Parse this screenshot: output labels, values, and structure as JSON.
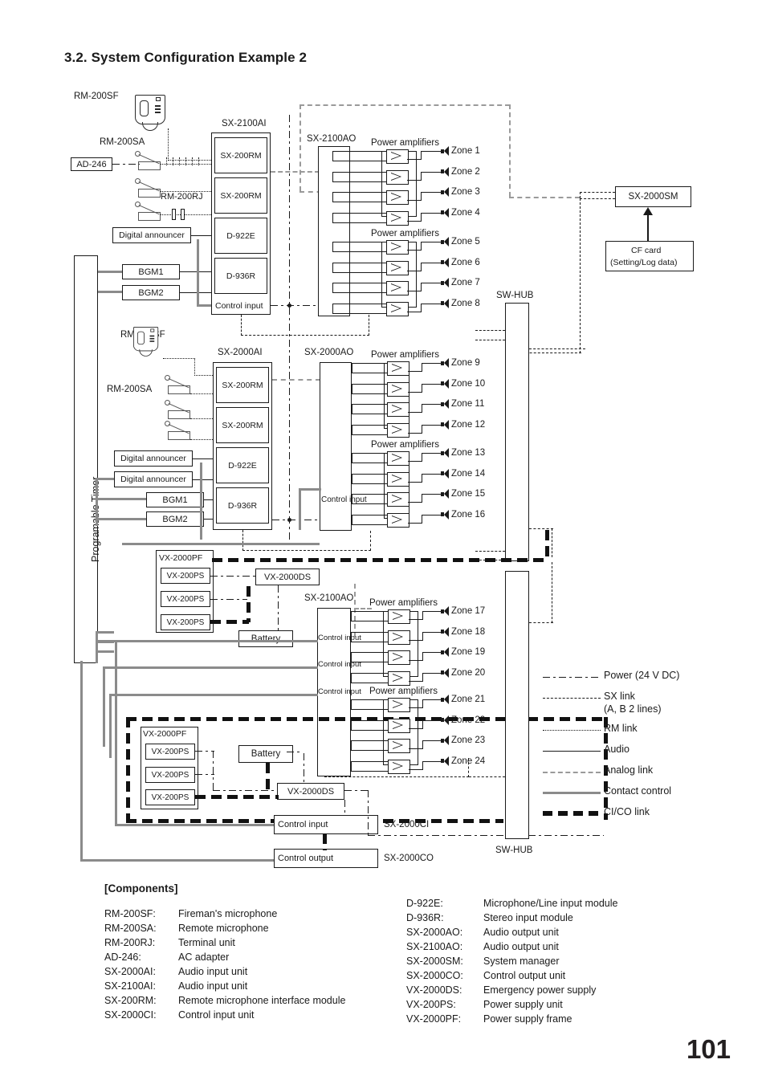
{
  "document": {
    "section_title": "3.2. System Configuration Example 2",
    "page_number": "101"
  },
  "diagram": {
    "programable_timer": "Programable Timer",
    "mic_top_label": "RM-200SF",
    "mic_mid_label": "RM-200SF",
    "rm200sa_top": "RM-200SA",
    "rm200sa_mid": "RM-200SA",
    "ad246": "AD-246",
    "rm200rj": "RM-200RJ",
    "sx2100ai_title": "SX-2100AI",
    "sx2000ai_title": "SX-2000AI",
    "sx2100ao_title_top": "SX-2100AO",
    "sx2000ao_title": "SX-2000AO",
    "sx2100ao_title_bottom": "SX-2100AO",
    "sx2000sm": "SX-2000SM",
    "cf_card_line1": "CF card",
    "cf_card_line2": "(Setting/Log data)",
    "sw_hub_top": "SW-HUB",
    "sw_hub_bottom": "SW-HUB",
    "modules_2100ai": [
      "SX-200RM",
      "SX-200RM",
      "D-922E",
      "D-936R",
      "Control input"
    ],
    "modules_2000ai": [
      "SX-200RM",
      "SX-200RM",
      "D-922E",
      "D-936R"
    ],
    "digital_announcer": "Digital announcer",
    "bgm1": "BGM1",
    "bgm2": "BGM2",
    "control_input": "Control input",
    "control_output": "Control output",
    "power_amplifiers": "Power amplifiers",
    "zones": [
      "Zone 1",
      "Zone 2",
      "Zone 3",
      "Zone 4",
      "Zone 5",
      "Zone 6",
      "Zone 7",
      "Zone 8",
      "Zone 9",
      "Zone 10",
      "Zone 11",
      "Zone 12",
      "Zone 13",
      "Zone 14",
      "Zone 15",
      "Zone 16",
      "Zone 17",
      "Zone 18",
      "Zone 19",
      "Zone 20",
      "Zone 21",
      "Zone 22",
      "Zone 23",
      "Zone 24"
    ],
    "vx2000pf": "VX-2000PF",
    "vx200ps": "VX-200PS",
    "vx2000ds": "VX-2000DS",
    "battery": "Battery",
    "sx2000ci": "SX-2000CI",
    "sx2000co": "SX-2000CO"
  },
  "legend": {
    "items": [
      {
        "label": "Power (24 V DC)",
        "style": "power-dash-dot",
        "color": "#1a1a1a"
      },
      {
        "label": "SX link",
        "sublabel": "(A, B 2 lines)",
        "style": "long-dash",
        "color": "#1a1a1a"
      },
      {
        "label": "RM link",
        "style": "dotted",
        "color": "#1a1a1a"
      },
      {
        "label": "Audio",
        "style": "solid",
        "color": "#1a1a1a"
      },
      {
        "label": "Analog link",
        "style": "gray-dashed",
        "color": "#9a9a9a"
      },
      {
        "label": "Contact control",
        "style": "gray-solid",
        "color": "#8b8b8b"
      },
      {
        "label": "CI/CO link",
        "style": "thick-dashed",
        "color": "#111111"
      }
    ]
  },
  "components": {
    "heading": "[Components]",
    "left": [
      {
        "code": "RM-200SF:",
        "desc": "Fireman's microphone"
      },
      {
        "code": "RM-200SA:",
        "desc": "Remote microphone"
      },
      {
        "code": "RM-200RJ:",
        "desc": "Terminal unit"
      },
      {
        "code": "AD-246:",
        "desc": "AC adapter"
      },
      {
        "code": "SX-2000AI:",
        "desc": "Audio input unit"
      },
      {
        "code": "SX-2100AI:",
        "desc": "Audio input unit"
      },
      {
        "code": "SX-200RM:",
        "desc": "Remote microphone interface module"
      },
      {
        "code": "SX-2000CI:",
        "desc": "Control input unit"
      }
    ],
    "right": [
      {
        "code": "D-922E:",
        "desc": "Microphone/Line input module"
      },
      {
        "code": "D-936R:",
        "desc": "Stereo input module"
      },
      {
        "code": "SX-2000AO:",
        "desc": "Audio output unit"
      },
      {
        "code": "SX-2100AO:",
        "desc": "Audio output unit"
      },
      {
        "code": "SX-2000SM:",
        "desc": "System manager"
      },
      {
        "code": "SX-2000CO:",
        "desc": "Control output unit"
      },
      {
        "code": "VX-2000DS:",
        "desc": "Emergency power supply"
      },
      {
        "code": "VX-200PS:",
        "desc": "Power supply unit"
      },
      {
        "code": "VX-2000PF:",
        "desc": "Power supply frame"
      }
    ]
  }
}
